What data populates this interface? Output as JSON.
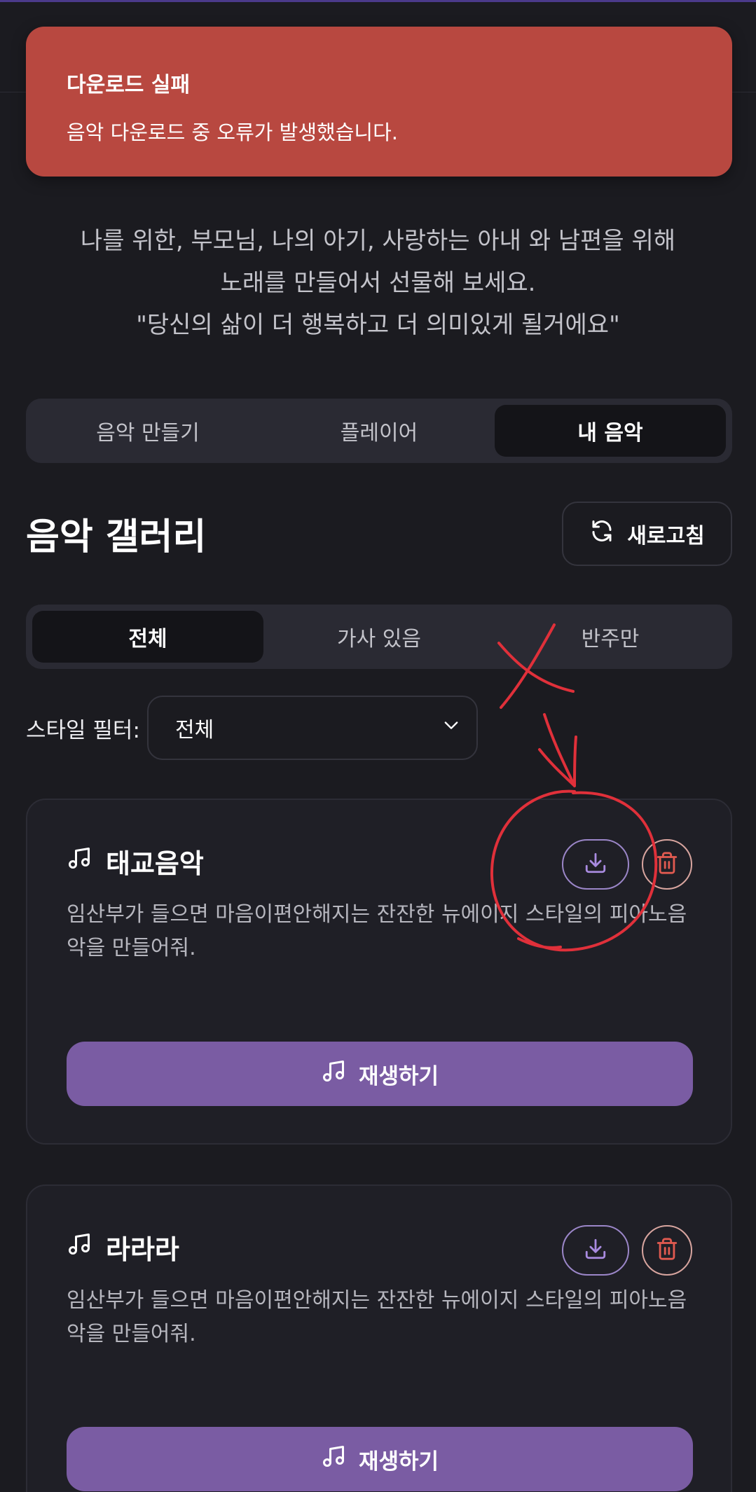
{
  "toast": {
    "title": "다운로드 실패",
    "message": "음악 다운로드 중 오류가 발생했습니다.",
    "color": "#b84840"
  },
  "header": {
    "description": [
      "나를 위한, 부모님, 나의 아기, 사랑하는 아내 와 남편을 위해",
      "노래를 만들어서 선물해 보세요.",
      "\"당신의 삶이 더 행복하고 더 의미있게 될거에요\""
    ]
  },
  "main_tabs": [
    {
      "label": "음악 만들기",
      "active": false
    },
    {
      "label": "플레이어",
      "active": false
    },
    {
      "label": "내 음악",
      "active": true
    }
  ],
  "gallery": {
    "title": "음악 갤러리",
    "refresh_label": "새로고침",
    "refresh_icon": "refresh-icon"
  },
  "filter_tabs": [
    {
      "label": "전체",
      "active": true
    },
    {
      "label": "가사 있음",
      "active": false
    },
    {
      "label": "반주만",
      "active": false
    }
  ],
  "style_filter": {
    "label": "스타일 필터:",
    "selected": "전체"
  },
  "songs": [
    {
      "title": "태교음악",
      "description": "임산부가 들으면 마음이편안해지는 잔잔한 뉴에이지 스타일의 피아노음악을 만들어줘.",
      "play_label": "재생하기"
    },
    {
      "title": "라라라",
      "description": "임산부가 들으면 마음이편안해지는 잔잔한 뉴에이지 스타일의 피아노음악을 만들어줘.",
      "play_label": "재생하기"
    }
  ],
  "colors": {
    "background": "#1b1b20",
    "accent_purple": "#7a5ca3",
    "download_icon": "#a98be0",
    "delete_icon": "#e05a50",
    "annotation_red": "#e0303a"
  }
}
